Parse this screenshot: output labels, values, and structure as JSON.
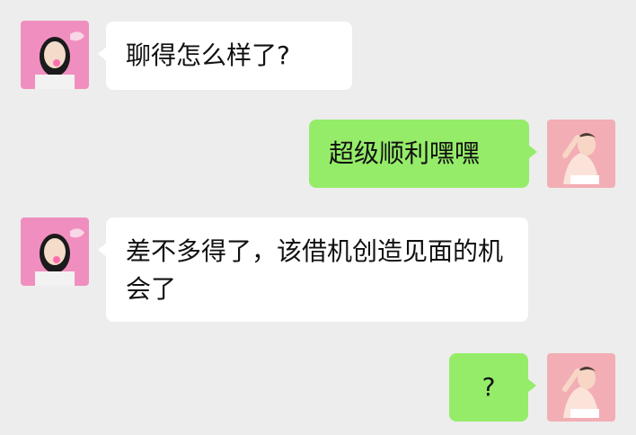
{
  "messages": [
    {
      "side": "in",
      "text": "聊得怎么样了?"
    },
    {
      "side": "out",
      "text": "超级顺利嘿嘿"
    },
    {
      "side": "in",
      "text": "差不多得了，该借机创造见面的机会了"
    },
    {
      "side": "out",
      "text": "?"
    }
  ],
  "avatars": {
    "left": "pink-bubblegum-girl-avatar",
    "right": "raised-arm-woman-avatar"
  },
  "colors": {
    "background": "#ededed",
    "incoming_bubble": "#ffffff",
    "outgoing_bubble": "#95ec69",
    "left_avatar_bg": "#f08fbf",
    "right_avatar_bg": "#f2aeb4"
  }
}
